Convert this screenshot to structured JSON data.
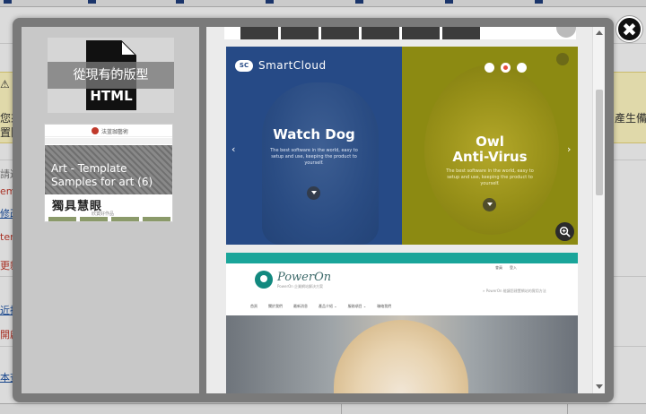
{
  "background": {
    "nav_items": [
      "",
      "",
      "",
      "",
      "",
      "",
      "",
      ""
    ],
    "warn_fragments": [
      "您來",
      "置隱",
      "產生備"
    ],
    "side_fragments": [
      "請遴",
      "em",
      "修改",
      "ter",
      "更新",
      "近接",
      "開啟",
      "本查"
    ]
  },
  "modal": {
    "close_label": "✖"
  },
  "templates": [
    {
      "label": "從現有的版型",
      "icon_text": "HTML"
    },
    {
      "label": "Art - Template Samples for art (6)",
      "site_logo_text": "法蓝珈藝術",
      "headline": "獨具慧眼",
      "subtitle": "欣賞好作品"
    }
  ],
  "previews": {
    "smartcloud": {
      "brand_badge": "SC",
      "brand_name": "SmartCloud",
      "slide1_title": "Watch Dog",
      "slide1_desc": "The best software in the world, easy to setup and use, keeping the product to yourself.",
      "slide2_title": "Owl\nAnti-Virus",
      "slide2_desc": "The best software in the world, easy to setup and use, keeping the product to yourself.",
      "arrow_prev": "‹",
      "arrow_next": "›"
    },
    "poweron": {
      "logo_text": "PowerOn",
      "tagline": "PowerOn 企業網站解決方案",
      "breadcrumb": "» PowerOn 能讓您建置網站的實用方法",
      "top_links": [
        "會員",
        "登入"
      ],
      "nav_items": [
        "首頁",
        "關於我們",
        "最新消息",
        "產品介紹 ⌄",
        "服務項目 ⌄",
        "聯絡我們"
      ]
    }
  }
}
